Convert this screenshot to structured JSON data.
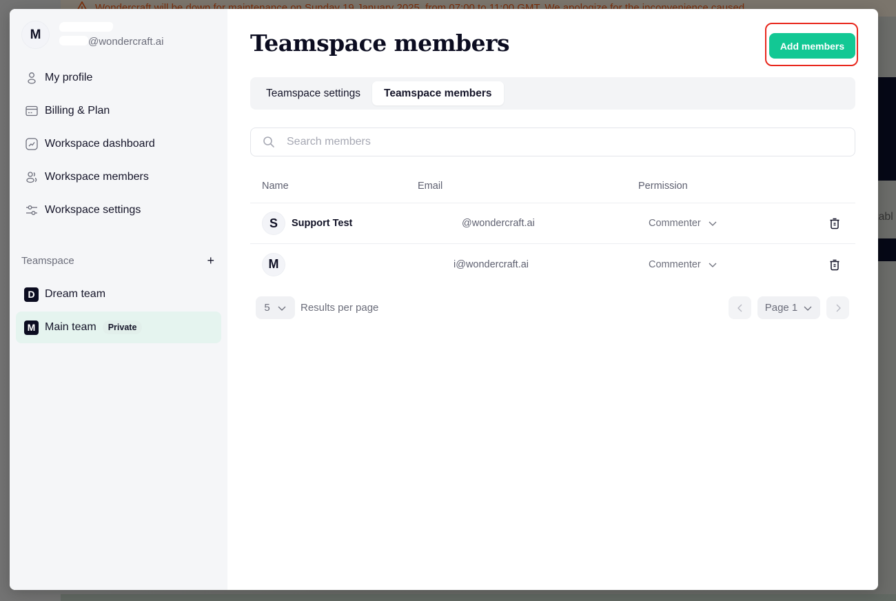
{
  "banner": {
    "icon": "warning-icon",
    "text": "Wondercraft will be down for maintenance on Sunday 19 January 2025, from 07:00 to 11:00 GMT. We apologize for the inconvenience caused."
  },
  "background": {
    "partial_text": "tabl"
  },
  "sidebar": {
    "account": {
      "avatar_initial": "M",
      "email_visible": "@wondercraft.ai"
    },
    "nav_items": [
      {
        "label": "My profile",
        "icon": "user-icon"
      },
      {
        "label": "Billing & Plan",
        "icon": "credit-card-icon"
      },
      {
        "label": "Workspace dashboard",
        "icon": "chart-icon"
      },
      {
        "label": "Workspace members",
        "icon": "users-icon"
      },
      {
        "label": "Workspace settings",
        "icon": "sliders-icon"
      }
    ],
    "teamspace": {
      "heading": "Teamspace",
      "add_icon": "+",
      "teams": [
        {
          "initial": "D",
          "name": "Dream team",
          "badge": null,
          "active": false
        },
        {
          "initial": "M",
          "name": "Main team",
          "badge": "Private",
          "active": true
        }
      ]
    }
  },
  "main": {
    "title": "Teamspace members",
    "add_button": "Add members",
    "accent_color": "#12c894",
    "highlight_color": "#e8271c",
    "tabs": [
      {
        "label": "Teamspace settings",
        "active": false
      },
      {
        "label": "Teamspace members",
        "active": true
      }
    ],
    "search": {
      "placeholder": "Search members",
      "value": ""
    },
    "table": {
      "columns": [
        "Name",
        "Email",
        "Permission"
      ],
      "rows": [
        {
          "initial": "S",
          "name": "Support Test",
          "email": "@wondercraft.ai",
          "permission": "Commenter"
        },
        {
          "initial": "M",
          "name": "",
          "email": "i@wondercraft.ai",
          "permission": "Commenter"
        }
      ]
    },
    "pagination": {
      "per_page": "5",
      "per_page_label": "Results per page",
      "page_label": "Page 1"
    }
  }
}
